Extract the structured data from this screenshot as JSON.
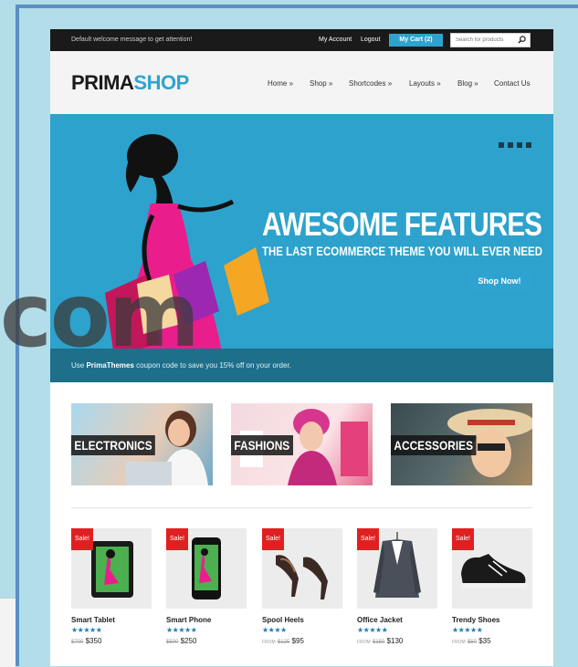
{
  "topbar": {
    "welcome": "Default welcome message to get attention!",
    "my_account": "My Account",
    "logout": "Logout",
    "cart": "My Cart (2)",
    "search_placeholder": "Search for products"
  },
  "header": {
    "logo_part1": "PRIMA",
    "logo_part2": "SHOP",
    "nav": [
      "Home »",
      "Shop »",
      "Shortcodes »",
      "Layouts »",
      "Blog »",
      "Contact Us"
    ]
  },
  "hero": {
    "headline": "AWESOME FEATURES",
    "tagline": "THE LAST ECOMMERCE THEME YOU WILL EVER NEED",
    "coupon_prefix": "Use ",
    "coupon_brand": "PrimaThemes",
    "coupon_suffix": " coupon code to save you 15% off on your order.",
    "shop_now": "Shop Now!"
  },
  "categories": [
    "ELECTRONICS",
    "FASHIONS",
    "ACCESSORIES"
  ],
  "products": [
    {
      "name": "Smart Tablet",
      "sale": "Sale!",
      "stars": "★★★★★",
      "from": "",
      "old": "$700",
      "price": "$350"
    },
    {
      "name": "Smart Phone",
      "sale": "Sale!",
      "stars": "★★★★★",
      "from": "",
      "old": "$500",
      "price": "$250"
    },
    {
      "name": "Spool Heels",
      "sale": "Sale!",
      "stars": "★★★★",
      "from": "FROM",
      "old": "$125",
      "price": "$95"
    },
    {
      "name": "Office Jacket",
      "sale": "Sale!",
      "stars": "★★★★★",
      "from": "FROM",
      "old": "$150",
      "price": "$130"
    },
    {
      "name": "Trendy Shoes",
      "sale": "Sale!",
      "stars": "★★★★★",
      "from": "FROM",
      "old": "$50",
      "price": "$35"
    }
  ],
  "watermark": "com",
  "colors": {
    "accent": "#2fa3cf",
    "dark": "#1a1a1a",
    "sale": "#e02020"
  }
}
